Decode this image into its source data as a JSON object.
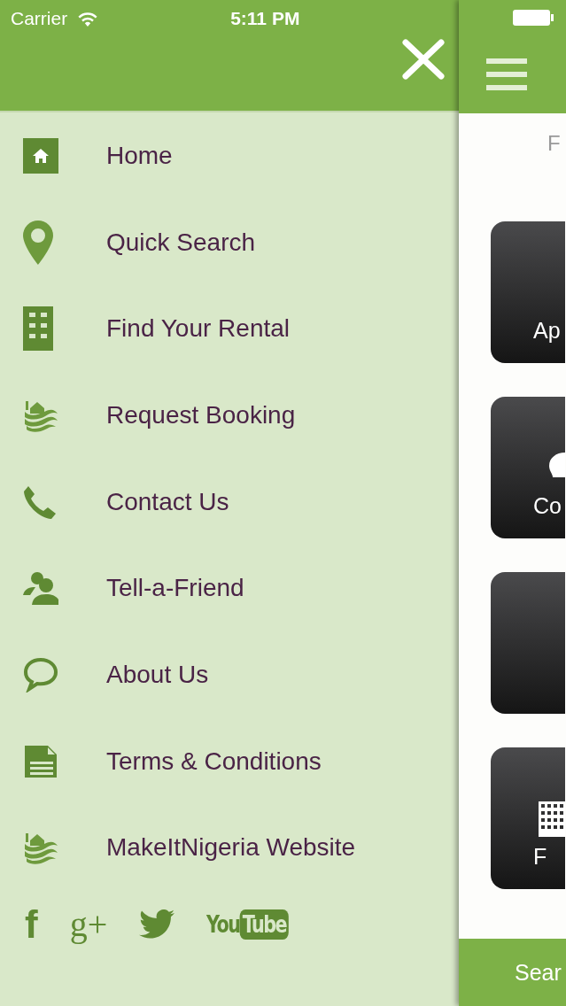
{
  "status_bar": {
    "carrier": "Carrier",
    "time": "5:11 PM"
  },
  "menu": [
    {
      "kind": "home",
      "label": "Home"
    },
    {
      "kind": "pin",
      "label": "Quick Search"
    },
    {
      "kind": "building",
      "label": "Find Your Rental"
    },
    {
      "kind": "logo",
      "label": "Request Booking"
    },
    {
      "kind": "phone",
      "label": "Contact Us"
    },
    {
      "kind": "people",
      "label": "Tell-a-Friend"
    },
    {
      "kind": "bubble",
      "label": "About Us"
    },
    {
      "kind": "document",
      "label": "Terms & Conditions"
    },
    {
      "kind": "logo",
      "label": "MakeItNigeria Website"
    }
  ],
  "social": [
    {
      "kind": "facebook",
      "label": "f"
    },
    {
      "kind": "googleplus",
      "label": "g+"
    },
    {
      "kind": "twitter"
    },
    {
      "kind": "youtube",
      "label": "You",
      "label_2": "Tube"
    }
  ],
  "main": {
    "heading": "F",
    "tiles": [
      {
        "kind": "plain",
        "label": "Ap"
      },
      {
        "kind": "bulb",
        "label": "Co"
      },
      {
        "kind": "plain"
      },
      {
        "kind": "grid",
        "label": "F"
      }
    ],
    "bottom_button": "Sear"
  }
}
